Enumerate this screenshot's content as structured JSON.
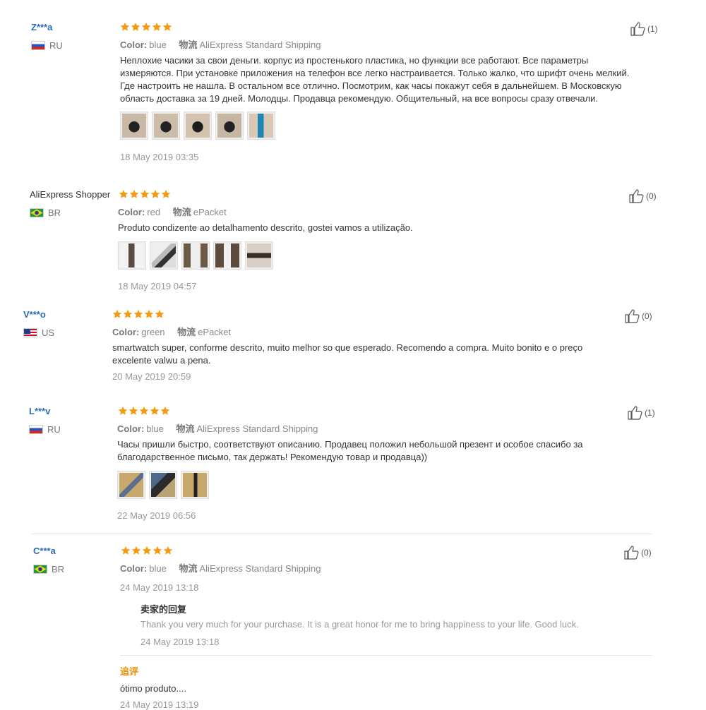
{
  "labels": {
    "color": "Color:",
    "shipping": "物流"
  },
  "colors": {
    "star": "#f39c12",
    "link": "#2a6ab8",
    "addtl": "#f08c00"
  },
  "reviews": [
    {
      "user": "Z***a",
      "country": "RU",
      "flag": "ru",
      "color_value": "blue",
      "shipping_value": "AliExpress Standard Shipping",
      "text_lines": [
        "Неплохие часики за свои деньги. корпус из простенького пластика, но функции все работают. Все параметры",
        "измеряются. При установке приложения на телефон все легко настраивается. Только жалко, что шрифт очень мелкий.",
        "Где настроить не нашла. В остальном все отлично. Посмотрим, как часы покажут себя в дальнейшем. В Московскую",
        "область доставка за 19 дней. Молодцы. Продавца рекомендую. Общительный, на все вопросы сразу отвечали."
      ],
      "date": "18 May 2019 03:35",
      "likes": "(1)",
      "stars": 5
    },
    {
      "user": "AliExpress Shopper",
      "country": "BR",
      "flag": "br",
      "color_value": "red",
      "shipping_value": "ePacket",
      "text_lines": [
        "Produto condizente ao detalhamento descrito, gostei vamos a utilização."
      ],
      "date": "18 May 2019 04:57",
      "likes": "(0)",
      "stars": 5
    },
    {
      "user": "V***o",
      "country": "US",
      "flag": "us",
      "color_value": "green",
      "shipping_value": "ePacket",
      "text_lines": [
        "smartwatch super, conforme descrito, muito melhor so que esperado. Recomendo a compra. Muito bonito e o preço",
        "excelente valwu a pena."
      ],
      "date": "20 May 2019 20:59",
      "likes": "(0)",
      "stars": 5
    },
    {
      "user": "L***v",
      "country": "RU",
      "flag": "ru",
      "color_value": "blue",
      "shipping_value": "AliExpress Standard Shipping",
      "text_lines": [
        "Часы пришли быстро, соответствуют описанию. Продавец положил небольшой презент и особое спасибо за",
        "благодарственное письмо, так держать! Рекомендую товар и продавца))"
      ],
      "date": "22 May 2019 06:56",
      "likes": "(1)",
      "stars": 5
    },
    {
      "user": "C***a",
      "country": "BR",
      "flag": "br",
      "color_value": "blue",
      "shipping_value": "AliExpress Standard Shipping",
      "date": "24 May 2019 13:18",
      "likes": "(0)",
      "stars": 5,
      "seller_reply": {
        "title": "卖家的回复",
        "text": "Thank you very much for your purchase. It is a great honor for me to bring happiness to your life. Good luck.",
        "date": "24 May 2019 13:18"
      },
      "additional": {
        "title": "追评",
        "text": "ótimo produto....",
        "date": "24 May 2019 13:19"
      }
    }
  ]
}
